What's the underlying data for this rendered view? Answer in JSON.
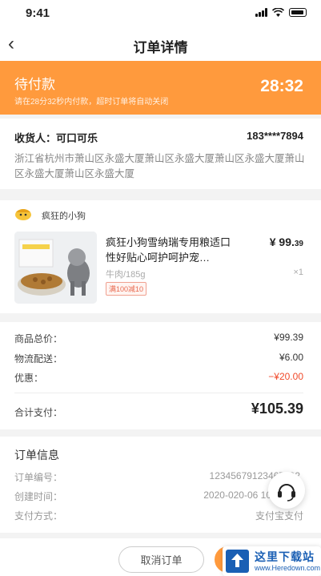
{
  "status_bar": {
    "time": "9:41"
  },
  "nav": {
    "back_icon": "chevron-left-icon",
    "title": "订单详情"
  },
  "banner": {
    "title": "待付款",
    "subtitle": "请在28分32秒内付款，超时订单将自动关闭",
    "timer": "28:32",
    "color": "#ff9a3d"
  },
  "address": {
    "recipient": "收货人：可口可乐",
    "phone": "183****7894",
    "detail": "浙江省杭州市萧山区永盛大厦萧山区永盛大厦萧山区永盛大厦萧山区永盛大厦萧山区永盛大厦"
  },
  "shop": {
    "name": "疯狂的小狗",
    "product": {
      "name": "疯狂小狗雪纳瑞专用粮适口性好贴心呵护呵护宠…",
      "price_main": "¥ 99.",
      "price_decimal": "39",
      "spec": "牛肉/185g",
      "quantity": "×1",
      "promo": "满100减10"
    }
  },
  "summary": {
    "items": [
      {
        "label": "商品总价：",
        "value": "¥99.39"
      },
      {
        "label": "物流配送：",
        "value": "¥6.00"
      },
      {
        "label": "优惠：",
        "value": "−¥20.00"
      }
    ],
    "total_label": "合计支付：",
    "total_value": "¥105.39",
    "discount_color": "#f04a2a"
  },
  "order_info": {
    "title": "订单信息",
    "rows": [
      {
        "label": "订单编号：",
        "value": "12345679123467892"
      },
      {
        "label": "创建时间：",
        "value": "2020-020-06 10"
      },
      {
        "label": "支付方式：",
        "value": "支付宝支付"
      }
    ]
  },
  "bottom_bar": {
    "cancel_label": "取消订单"
  },
  "watermark": {
    "main": "这里下载站",
    "sub": "www.Heredown.com"
  }
}
